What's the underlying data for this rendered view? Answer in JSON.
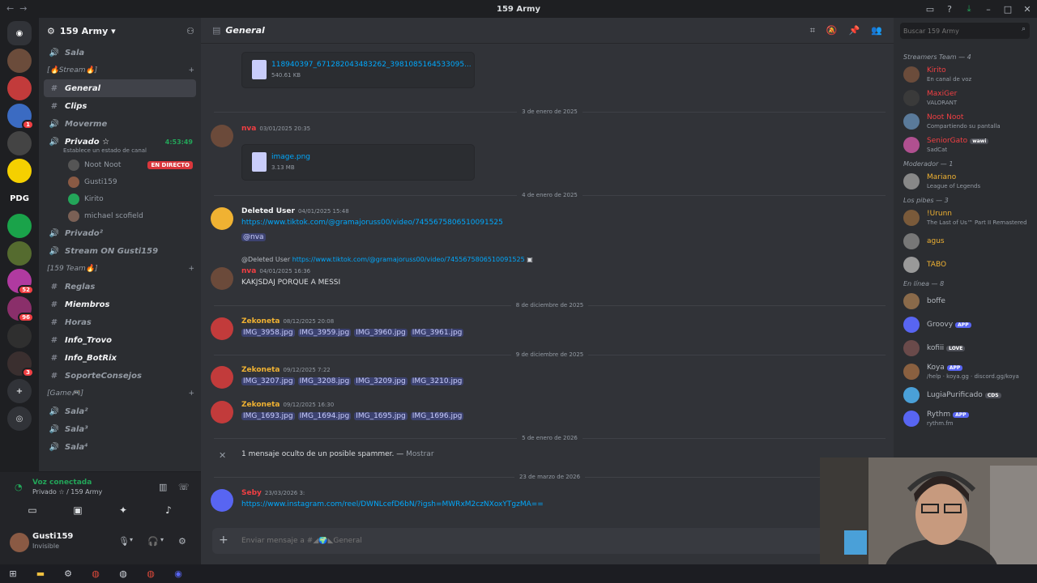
{
  "window": {
    "title": "159 Army"
  },
  "guilds": {
    "items": [
      "PDG"
    ]
  },
  "server": {
    "name": "159 Army"
  },
  "sidebar": {
    "items": [
      {
        "label": "Sala",
        "sym": "🔊"
      },
      {
        "label": "[🔥Stream🔥]",
        "category": true
      },
      {
        "label": "General",
        "sym": "#",
        "active": true
      },
      {
        "label": "Clips",
        "sym": "#",
        "bright": true
      },
      {
        "label": "Moverme",
        "sym": "🔊"
      },
      {
        "label": "Privado ☆",
        "sym": "🔊",
        "bright": true,
        "timer": "4:53:49"
      }
    ],
    "status_hint": "Establece un estado de canal",
    "voice_users": [
      {
        "name": "Noot Noot",
        "live": "EN DIRECTO"
      },
      {
        "name": "Gusti159"
      },
      {
        "name": "Kirito"
      },
      {
        "name": "michael scofield"
      }
    ],
    "items2": [
      {
        "label": "Privado²",
        "sym": "🔊"
      },
      {
        "label": "Stream ON Gusti159",
        "sym": "🔊"
      },
      {
        "label": "[159 Team🔥]",
        "category": true
      },
      {
        "label": "Reglas",
        "sym": "#"
      },
      {
        "label": "Miembros",
        "sym": "#",
        "bright": true
      },
      {
        "label": "Horas",
        "sym": "#"
      },
      {
        "label": "Info_Trovo",
        "sym": "#",
        "bright": true
      },
      {
        "label": "Info_BotRix",
        "sym": "#",
        "bright": true
      },
      {
        "label": "SoporteConsejos",
        "sym": "#"
      },
      {
        "label": "[Game🎮]",
        "category": true
      },
      {
        "label": "Sala²",
        "sym": "🔊"
      },
      {
        "label": "Sala³",
        "sym": "🔊"
      },
      {
        "label": "Sala⁴",
        "sym": "🔊"
      }
    ]
  },
  "voice_panel": {
    "title": "Voz conectada",
    "sub": "Privado ☆ / 159 Army"
  },
  "user_panel": {
    "name": "Gusti159",
    "status": "Invisible"
  },
  "chat": {
    "channel_name": "General",
    "files": [
      {
        "name": "118940397_671282043483262_3981085164533095...",
        "size": "540.61 KB"
      },
      {
        "name": "image.png",
        "size": "3.13 MB"
      }
    ],
    "dividers": [
      "3 de enero de 2025",
      "4 de enero de 2025",
      "8 de diciembre de 2025",
      "9 de diciembre de 2025",
      "5 de enero de 2026",
      "23 de marzo de 2026"
    ],
    "messages": [
      {
        "author": "nva",
        "ts": "03/01/2025 20:35"
      },
      {
        "author": "Deleted User",
        "ts": "04/01/2025 15:48",
        "link": "https://www.tiktok.com/@gramajoruss00/video/7455675806510091525",
        "mention": "@nva"
      },
      {
        "reply_author": "@Deleted User",
        "reply_link": "https://www.tiktok.com/@gramajoruss00/video/7455675806510091525",
        "author": "nva",
        "ts": "04/01/2025 16:36",
        "text": "KAKJSDAJ PORQUE A MESSI"
      },
      {
        "author": "Zekoneta",
        "ts": "08/12/2025 20:08",
        "attachments": [
          "IMG_3958.jpg",
          "IMG_3959.jpg",
          "IMG_3960.jpg",
          "IMG_3961.jpg"
        ]
      },
      {
        "author": "Zekoneta",
        "ts": "09/12/2025 7:22",
        "attachments": [
          "IMG_3207.jpg",
          "IMG_3208.jpg",
          "IMG_3209.jpg",
          "IMG_3210.jpg"
        ]
      },
      {
        "author": "Zekoneta",
        "ts": "09/12/2025 16:30",
        "attachments": [
          "IMG_1693.jpg",
          "IMG_1694.jpg",
          "IMG_1695.jpg",
          "IMG_1696.jpg"
        ]
      },
      {
        "author": "Seby",
        "ts": "23/03/2026 3:",
        "link": "https://www.instagram.com/reel/DWNLcefD6bN/?igsh=MWRxM2czNXoxYTgzMA=="
      }
    ],
    "spam_notice": "1 mensaje oculto de un posible spammer. — ",
    "spam_show": "Mostrar",
    "composer_placeholder": "Enviar mensaje a #◢🌍◣General"
  },
  "members": {
    "search_placeholder": "Buscar 159 Army",
    "groups": [
      {
        "title": "Streamers Team — 4",
        "members": [
          {
            "name": "Kirito",
            "status": "En canal de voz",
            "color": "#f23f43"
          },
          {
            "name": "MaxiGer",
            "status": "VALORANT",
            "color": "#f23f43"
          },
          {
            "name": "Noot Noot",
            "status": "Compartiendo su pantalla",
            "color": "#f23f43"
          },
          {
            "name": "SeniorGato",
            "status": "SadCat",
            "color": "#f23f43",
            "badge": "wawi"
          }
        ]
      },
      {
        "title": "Moderador — 1",
        "members": [
          {
            "name": "Mariano",
            "status": "League of Legends",
            "color": "#f0b232"
          }
        ]
      },
      {
        "title": "Los pibes — 3",
        "members": [
          {
            "name": "!Urunn",
            "status": "The Last of Us™ Part II Remastered",
            "color": "#f0b232"
          },
          {
            "name": "agus",
            "status": "",
            "color": "#f0b232"
          },
          {
            "name": "TABO",
            "status": "",
            "color": "#f0b232"
          }
        ]
      },
      {
        "title": "En línea — 8",
        "members": [
          {
            "name": "boffe",
            "status": "",
            "color": "#b5bac1"
          },
          {
            "name": "Groovy",
            "status": "",
            "color": "#b5bac1",
            "app": "APP"
          },
          {
            "name": "kofiii",
            "status": "",
            "color": "#b5bac1",
            "badge": "LOVE"
          },
          {
            "name": "Koya",
            "status": "/help · koya.gg · discord.gg/koya",
            "color": "#b5bac1",
            "app": "APP"
          },
          {
            "name": "LugiaPurificado",
            "status": "",
            "color": "#b5bac1",
            "badge": "CDS"
          },
          {
            "name": "Rythm",
            "status": "rythm.fm",
            "color": "#b5bac1",
            "app": "APP"
          }
        ]
      }
    ]
  }
}
